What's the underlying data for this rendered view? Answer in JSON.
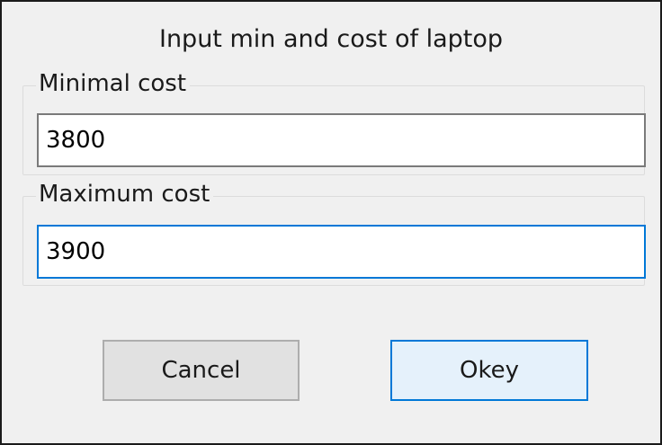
{
  "dialog": {
    "title": "Input min and cost of laptop"
  },
  "min_group": {
    "label": "Minimal cost",
    "value": "3800"
  },
  "max_group": {
    "label": "Maximum cost",
    "value": "3900"
  },
  "buttons": {
    "cancel_label": "Cancel",
    "ok_label": "Okey"
  },
  "colors": {
    "focus_accent": "#0078d7",
    "default_button_bg": "#e5f1fb",
    "button_bg": "#e1e1e1",
    "dialog_bg": "#f0f0f0"
  }
}
